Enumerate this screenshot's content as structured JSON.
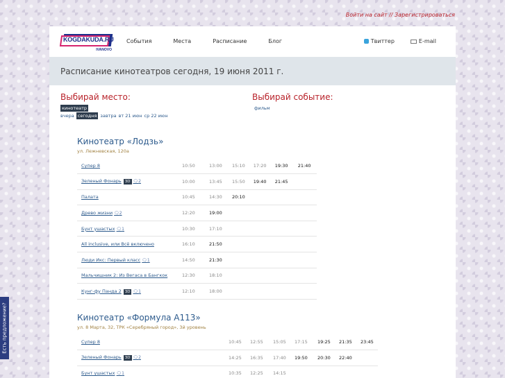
{
  "top": {
    "login": "Войти на сайт",
    "sep": " // ",
    "register": "Зарегистрироваться"
  },
  "logo": {
    "text": "KOGDAKUDA.RU",
    "sub": "IVANOVO"
  },
  "nav": [
    "События",
    "Места",
    "Расписание",
    "Блог"
  ],
  "social": {
    "twitter": "Твиттер",
    "email": "E-mail"
  },
  "banner": "Расписание кинотеатров сегодня, 19 июня 2011 г.",
  "place": {
    "title": "Выбирай место:",
    "tag": "кинотеатр",
    "days": [
      "вчера",
      "сегодня",
      "завтра",
      "вт 21 июн",
      "ср 22 июн"
    ]
  },
  "event": {
    "title": "Выбирай событие:",
    "tag": "фильм"
  },
  "side": "Есть предложение?",
  "cinemas": [
    {
      "name": "Кинотеатр «Лодзь»",
      "addr": "ул. Лежневская, 120а",
      "rows": [
        {
          "film": "Супер 8",
          "d3": "",
          "cm": "",
          "times": [
            "10:50",
            "13:00",
            "15:10",
            "17:20",
            "19:30",
            "21:40"
          ],
          "bold": [
            4,
            5
          ]
        },
        {
          "film": "Зеленый Фонарь",
          "d3": "3D",
          "cm": "2",
          "times": [
            "10:00",
            "13:45",
            "15:50",
            "19:40",
            "21:45",
            ""
          ],
          "bold": [
            3,
            4
          ]
        },
        {
          "film": "Палата",
          "d3": "",
          "cm": "",
          "times": [
            "10:45",
            "14:30",
            "20:10",
            "",
            "",
            ""
          ],
          "bold": [
            2
          ]
        },
        {
          "film": "Древо жизни",
          "d3": "",
          "cm": "2",
          "times": [
            "12:20",
            "19:00",
            "",
            "",
            "",
            ""
          ],
          "bold": [
            1
          ]
        },
        {
          "film": "Бунт ушастых",
          "d3": "",
          "cm": "1",
          "times": [
            "10:30",
            "17:10",
            "",
            "",
            "",
            ""
          ],
          "bold": []
        },
        {
          "film": "All inclusive, или Всё включено",
          "d3": "",
          "cm": "",
          "times": [
            "16:10",
            "21:50",
            "",
            "",
            "",
            ""
          ],
          "bold": [
            1
          ]
        },
        {
          "film": "Люди Икс: Первый класс",
          "d3": "",
          "cm": "1",
          "times": [
            "14:50",
            "21:30",
            "",
            "",
            "",
            ""
          ],
          "bold": [
            1
          ]
        },
        {
          "film": "Мальчишник 2: Из Вегаса в Бангкок",
          "d3": "",
          "cm": "",
          "times": [
            "12:30",
            "18:10",
            "",
            "",
            "",
            ""
          ],
          "bold": []
        },
        {
          "film": "Кунг-фу Панда 2",
          "d3": "3D",
          "cm": "1",
          "times": [
            "12:10",
            "18:00",
            "",
            "",
            "",
            ""
          ],
          "bold": []
        }
      ]
    },
    {
      "name": "Кинотеатр «Формула А113»",
      "addr": "ул. 8 Марта, 32, ТРК «Серебряный город», 3й уровень",
      "rows": [
        {
          "film": "Супер 8",
          "d3": "",
          "cm": "",
          "times": [
            "10:45",
            "12:55",
            "15:05",
            "17:15",
            "19:25",
            "21:35",
            "23:45"
          ],
          "bold": [
            4,
            5,
            6
          ]
        },
        {
          "film": "Зеленый Фонарь",
          "d3": "3D",
          "cm": "2",
          "times": [
            "14:25",
            "16:35",
            "17:40",
            "19:50",
            "20:30",
            "22:40",
            ""
          ],
          "bold": [
            3,
            4,
            5
          ]
        },
        {
          "film": "Бунт ушастых",
          "d3": "",
          "cm": "1",
          "times": [
            "10:35",
            "12:25",
            "14:15",
            "",
            "",
            "",
            ""
          ],
          "bold": []
        }
      ]
    }
  ]
}
